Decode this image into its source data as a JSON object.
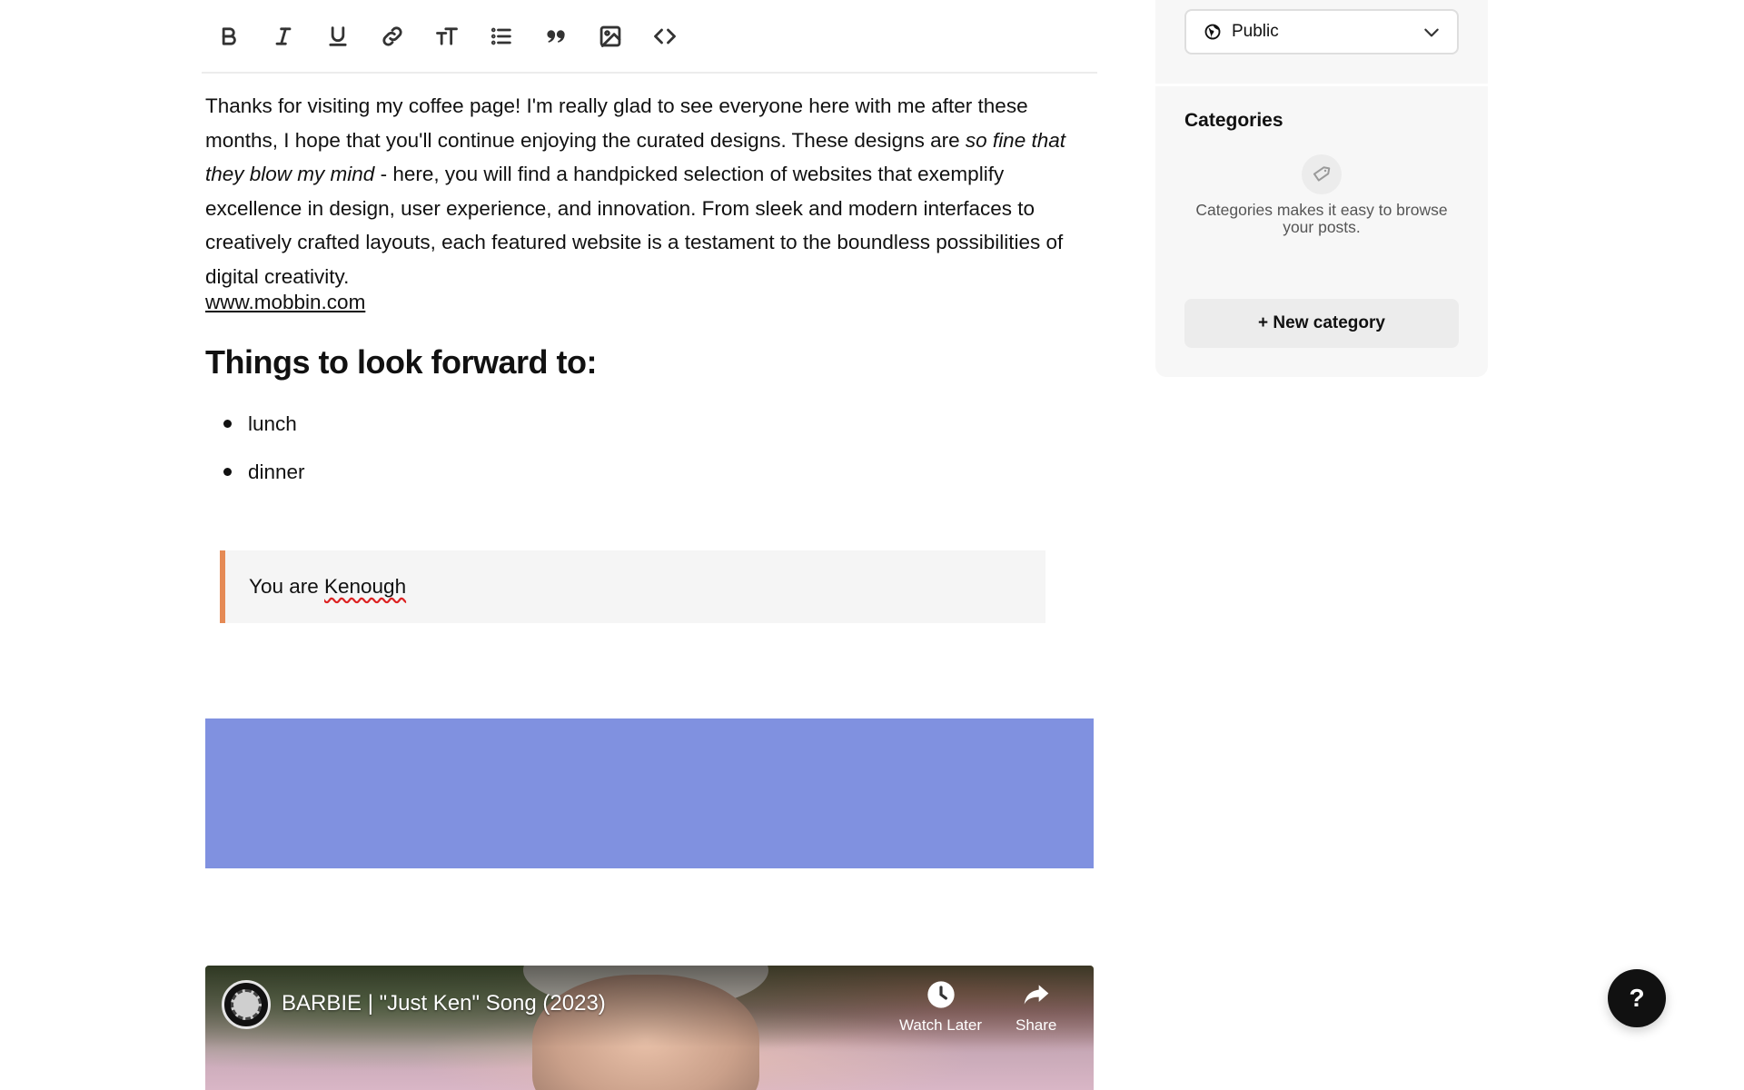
{
  "toolbar": {
    "buttons": [
      {
        "name": "bold-icon"
      },
      {
        "name": "italic-icon"
      },
      {
        "name": "underline-icon"
      },
      {
        "name": "link-icon"
      },
      {
        "name": "text-size-icon"
      },
      {
        "name": "bulleted-list-icon"
      },
      {
        "name": "quote-icon"
      },
      {
        "name": "image-icon"
      },
      {
        "name": "code-icon"
      }
    ]
  },
  "editor": {
    "paragraph_part1": "Thanks for visiting my coffee page! I'm really glad to see everyone here with me after these months, I hope that you'll continue enjoying the curated designs. These designs are ",
    "paragraph_italic": "so fine that they blow my mind",
    "paragraph_part2": " - here, you will find a handpicked selection of websites that exemplify excellence in design, user experience, and innovation. From sleek and modern interfaces to creatively crafted layouts, each featured website is a testament to the boundless possibilities of digital creativity.",
    "link_text": "www.mobbin.com",
    "heading": "Things to look forward to:",
    "bullets": [
      "lunch",
      "dinner"
    ],
    "quote_prefix": "You are ",
    "quote_misspelled": "Kenough",
    "color_block": "#8091e0",
    "quote_border_color": "#e58a55"
  },
  "video": {
    "title": "BARBIE | \"Just Ken\" Song (2023)",
    "watch_later_label": "Watch Later",
    "share_label": "Share"
  },
  "sidebar": {
    "visibility": {
      "selected": "Public",
      "icon": "globe-icon"
    },
    "categories": {
      "title": "Categories",
      "icon": "tag-icon",
      "description": "Categories makes it easy to browse your posts.",
      "new_button_label": "+ New category"
    }
  },
  "help_button": {
    "label": "?"
  }
}
